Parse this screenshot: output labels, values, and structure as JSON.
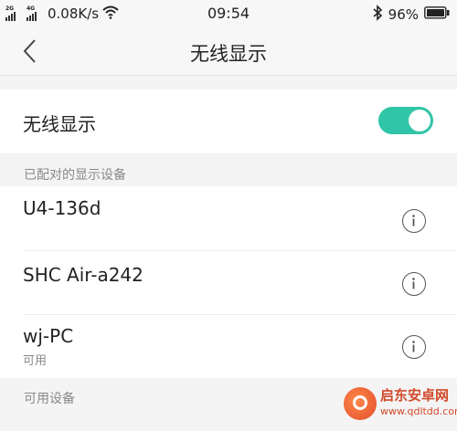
{
  "status_bar": {
    "network_1": "2G",
    "network_2": "4G",
    "speed": "0.08K/s",
    "time": "09:54",
    "battery": "96%"
  },
  "nav": {
    "title": "无线显示"
  },
  "toggle": {
    "label": "无线显示",
    "on": true,
    "accent_color": "#30c5a7"
  },
  "paired_section": {
    "header": "已配对的显示设备",
    "devices": [
      {
        "name": "U4-136d",
        "status": ""
      },
      {
        "name": "SHC Air-a242",
        "status": ""
      },
      {
        "name": "wj-PC",
        "status": "可用"
      }
    ]
  },
  "available_section": {
    "header": "可用设备"
  },
  "watermark": {
    "name": "启东安卓网",
    "url": "www.qdltdd.com"
  }
}
